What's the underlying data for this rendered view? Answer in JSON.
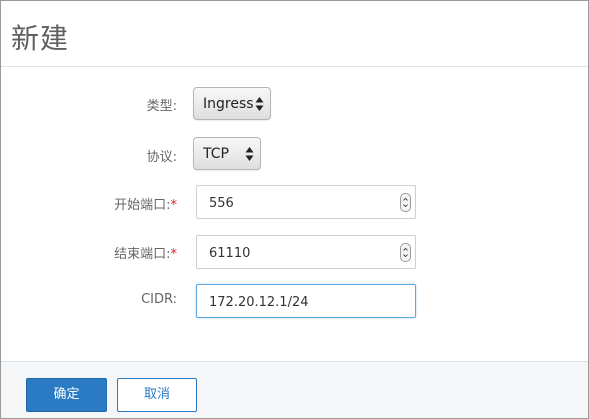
{
  "dialog": {
    "title": "新建"
  },
  "form": {
    "type": {
      "label": "类型:",
      "value": "Ingress"
    },
    "protocol": {
      "label": "协议:",
      "value": "TCP"
    },
    "start_port": {
      "label": "开始端口:",
      "required_mark": "*",
      "value": "556"
    },
    "end_port": {
      "label": "结束端口:",
      "required_mark": "*",
      "value": "61110"
    },
    "cidr": {
      "label": "CIDR:",
      "value": "172.20.12.1/24"
    }
  },
  "footer": {
    "confirm_label": "确定",
    "cancel_label": "取消"
  },
  "colors": {
    "primary": "#2a7bc4",
    "required": "#e0212b",
    "focus_border": "#5ea9dd"
  }
}
